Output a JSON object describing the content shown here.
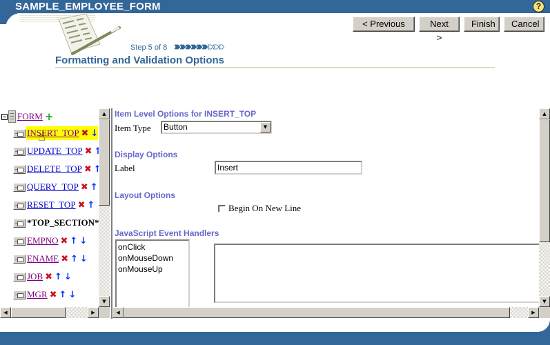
{
  "header": {
    "app_title": "SAMPLE_EMPLOYEE_FORM",
    "help_icon": "?"
  },
  "wizard": {
    "buttons": {
      "previous": "< Previous",
      "next": "Next >",
      "finish": "Finish",
      "cancel": "Cancel"
    },
    "step_text": "Step 5 of 8",
    "step_current": 5,
    "step_total": 8,
    "page_title": "Formatting and Validation Options"
  },
  "tree": {
    "root": {
      "label": "FORM",
      "expand_icon": "minus-box",
      "add_icon": "+"
    },
    "nodes": [
      {
        "label": "INSERT_TOP",
        "link": true,
        "selected": true,
        "delete": true,
        "up": false,
        "down": true,
        "visited": true
      },
      {
        "label": "UPDATE_TOP",
        "link": true,
        "selected": false,
        "delete": true,
        "up": true,
        "down": false,
        "visited": false
      },
      {
        "label": "DELETE_TOP",
        "link": true,
        "selected": false,
        "delete": true,
        "up": true,
        "down": false,
        "visited": false
      },
      {
        "label": "QUERY_TOP",
        "link": true,
        "selected": false,
        "delete": true,
        "up": true,
        "down": false,
        "visited": false
      },
      {
        "label": "RESET_TOP",
        "link": true,
        "selected": false,
        "delete": true,
        "up": true,
        "down": false,
        "visited": false
      },
      {
        "label": "*TOP_SECTION*",
        "link": false,
        "selected": false,
        "delete": false,
        "up": false,
        "down": false
      },
      {
        "label": "EMPNO",
        "link": true,
        "selected": false,
        "delete": true,
        "up": true,
        "down": true,
        "visited": true
      },
      {
        "label": "ENAME",
        "link": true,
        "selected": false,
        "delete": true,
        "up": true,
        "down": true,
        "visited": true
      },
      {
        "label": "JOB",
        "link": true,
        "selected": false,
        "delete": true,
        "up": true,
        "down": true,
        "visited": true
      },
      {
        "label": "MGR",
        "link": true,
        "selected": false,
        "delete": true,
        "up": true,
        "down": true,
        "visited": true
      }
    ],
    "icons": {
      "delete": "✖",
      "up": "🡅",
      "down": "🡇"
    }
  },
  "options": {
    "item_level_heading": "Item Level Options for INSERT_TOP",
    "item_type_label": "Item Type",
    "item_type_value": "Button",
    "display_heading": "Display Options",
    "label_label": "Label",
    "label_value": "Insert",
    "layout_heading": "Layout Options",
    "begin_new_line_label": "Begin On New Line",
    "begin_new_line_checked": false,
    "js_heading": "JavaScript Event Handlers",
    "js_events": [
      "onClick",
      "onMouseDown",
      "onMouseUp"
    ],
    "js_code": ""
  },
  "colors": {
    "brand_blue": "#336699",
    "section_heading": "#6666cc",
    "selected_highlight": "#ffff00",
    "delete_red": "#cc1122",
    "arrow_blue": "#0033ff",
    "add_green": "#22aa22"
  }
}
